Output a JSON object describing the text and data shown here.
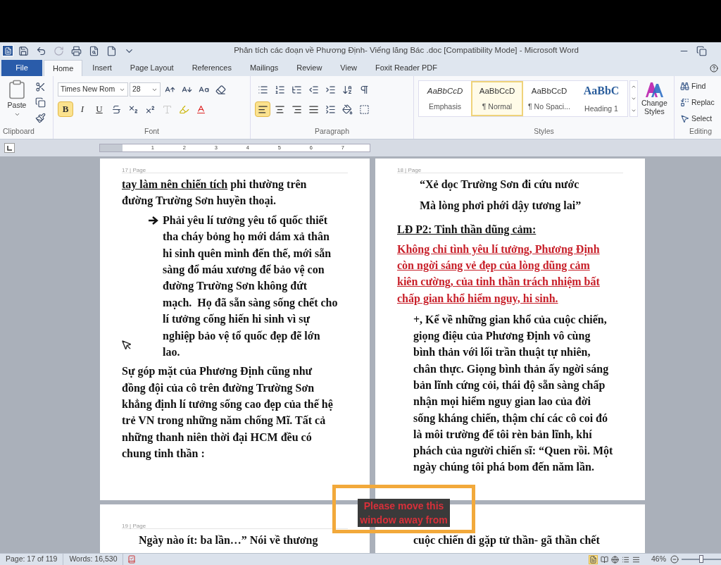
{
  "window": {
    "title": "Phân tích các đoạn về Phương Định- Viếng lăng Bác .doc [Compatibility Mode] - Microsoft Word"
  },
  "tabs": [
    {
      "label": "File",
      "kind": "file",
      "selected": false
    },
    {
      "label": "Home",
      "kind": "tab",
      "selected": true
    },
    {
      "label": "Insert",
      "kind": "tab",
      "selected": false
    },
    {
      "label": "Page Layout",
      "kind": "tab",
      "selected": false
    },
    {
      "label": "References",
      "kind": "tab",
      "selected": false
    },
    {
      "label": "Mailings",
      "kind": "tab",
      "selected": false
    },
    {
      "label": "Review",
      "kind": "tab",
      "selected": false
    },
    {
      "label": "View",
      "kind": "tab",
      "selected": false
    },
    {
      "label": "Foxit Reader PDF",
      "kind": "tab",
      "selected": false
    }
  ],
  "ribbon": {
    "clipboard": {
      "paste_label": "Paste",
      "group_label": "Clipboard"
    },
    "font": {
      "font_name": "Times New Rom",
      "font_size": "28",
      "group_label": "Font",
      "format_buttons": [
        {
          "label": "B",
          "kind": "bold",
          "selected": true
        },
        {
          "label": "I",
          "kind": "italic",
          "selected": false
        },
        {
          "label": "U",
          "kind": "underline",
          "selected": false
        }
      ]
    },
    "paragraph": {
      "group_label": "Paragraph",
      "alignments": [
        {
          "kind": "left",
          "selected": true
        },
        {
          "kind": "center",
          "selected": false
        },
        {
          "kind": "right",
          "selected": false
        },
        {
          "kind": "justify",
          "selected": false
        }
      ]
    },
    "styles": {
      "group_label": "Styles",
      "tiles": [
        {
          "preview": "AaBbCcD",
          "name": "Emphasis",
          "kind": "emphasis",
          "selected": false
        },
        {
          "preview": "AaBbCcD",
          "name": "¶ Normal",
          "kind": "normal",
          "selected": true
        },
        {
          "preview": "AaBbCcD",
          "name": "¶ No Spaci...",
          "kind": "normal",
          "selected": false
        },
        {
          "preview": "AaBbC",
          "name": "Heading 1",
          "kind": "heading",
          "selected": false
        }
      ],
      "change_styles": "Change Styles"
    },
    "editing": {
      "group_label": "Editing",
      "items": [
        {
          "label": "Find",
          "kind": "find"
        },
        {
          "label": "Replac",
          "kind": "replace"
        },
        {
          "label": "Select",
          "kind": "select"
        }
      ]
    }
  },
  "ruler": {
    "labels": [
      "1",
      "2",
      "3",
      "4",
      "5",
      "6",
      "7"
    ]
  },
  "pages": [
    {
      "header": "17 | Page",
      "paragraphs": [
        {
          "kind": "plain",
          "lead": "tay làm nên chiến tích",
          "lines": [
            " phi thường trên",
            "đường Trường Sơn huyền thoại."
          ]
        },
        {
          "kind": "arrow",
          "lines": [
            "Phải yêu lí tưởng yêu tổ quốc thiết",
            "tha cháy bỏng họ mới dám xả thân",
            "hi sinh quên mình đến thế, mới sẵn",
            "sàng đổ máu xương để bảo vệ con",
            "đường Trường Sơn không đứt",
            "mạch.  Họ đã sẵn sàng sống chết cho",
            "lí tưởng cống hiến hi sinh vì sự",
            "nghiệp bảo vệ tổ quốc đẹp đẽ lớn",
            "lao."
          ]
        },
        {
          "kind": "plain",
          "lines": [
            "Sự góp mặt của Phương Định cũng như",
            "đồng đội của cô trên đường Trường Sơn",
            "khẳng định lí tưởng sống cao đẹp của thế hệ",
            "trẻ VN trong những năm chống Mĩ. Tất cả",
            "những thanh niên thời đại HCM đều có",
            "chung tinh thần :"
          ]
        }
      ]
    },
    {
      "header": "18 | Page",
      "paragraphs": [
        {
          "kind": "quote",
          "lines": [
            "“Xẻ dọc Trường Sơn đi cứu nước",
            "Mà lòng phơi phới dậy tương lai”"
          ]
        },
        {
          "kind": "heading",
          "lines": [
            "LĐ P2: Tinh thần dũng cảm:"
          ]
        },
        {
          "kind": "red",
          "lines": [
            "Không chỉ tình yêu lí tưởng, Phương Định",
            "còn ngời sáng vẻ đẹp của lòng dũng cảm",
            "kiên cường, của tinh thần trách nhiệm bất",
            "chấp gian khổ hiểm nguy, hi sinh."
          ]
        },
        {
          "kind": "indent",
          "lines": [
            "+, Kể về những gian khổ của cuộc chiến,",
            "giọng điệu của Phương Định vô cùng",
            "bình thản với lối trần thuật tự nhiên,",
            "chân thực. Giọng bình thản ấy ngời sáng",
            "bản lĩnh cứng cỏi, thái độ sẵn sàng chấp",
            "nhận mọi hiểm nguy gian lao của đời",
            "sống kháng chiến, thậm chí các cô coi đó",
            "là môi trường để tôi rèn bản lĩnh, khí",
            "phách của người chiến sĩ: “Quen rồi. Một",
            "ngày chúng tôi phá bom đến năm lần."
          ]
        }
      ]
    },
    {
      "header": "19 | Page",
      "paragraphs": [
        {
          "kind": "plain-centered",
          "lines": [
            "Ngày nào ít: ba lần…” Nói về thương"
          ]
        }
      ]
    },
    {
      "paragraphs": [
        {
          "kind": "indent",
          "lines": [
            "cuộc chiến đi gặp tử thần- gã thần chết"
          ]
        }
      ]
    }
  ],
  "overlay": {
    "lines": [
      "Please move this",
      "window away from"
    ]
  },
  "status_bar": {
    "page": "Page: 17 of 119",
    "words": "Words: 16,530",
    "zoom": "46%",
    "zoom_slider": {
      "level": 0.5
    }
  }
}
